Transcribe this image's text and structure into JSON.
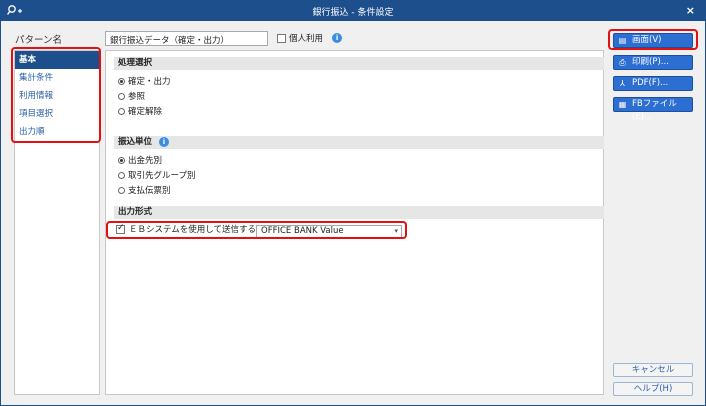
{
  "window": {
    "title": "銀行振込 - 条件設定",
    "close_symbol": "×"
  },
  "header": {
    "pattern_label": "パターン名",
    "pattern_value": "銀行振込データ（確定・出力）",
    "personal_label": "個人利用"
  },
  "sidebar": {
    "items": [
      {
        "label": "基本"
      },
      {
        "label": "集計条件"
      },
      {
        "label": "利用情報"
      },
      {
        "label": "項目選択"
      },
      {
        "label": "出力順"
      }
    ]
  },
  "sections": {
    "processing": {
      "title": "処理選択",
      "options": [
        "確定・出力",
        "参照",
        "確定解除"
      ],
      "selected": "確定・出力"
    },
    "unit": {
      "title": "振込単位",
      "options": [
        "出金先別",
        "取引先グループ別",
        "支払伝票別"
      ],
      "selected": "出金先別"
    },
    "output": {
      "title": "出力形式",
      "eb_label": "ＥＢシステムを使用して送信する",
      "eb_checked": true,
      "eb_value": "OFFICE BANK Value"
    }
  },
  "actions": {
    "screen": "画面(V)",
    "print": "印刷(P)...",
    "pdf": "PDF(F)...",
    "fb": "FBファイル(E)...",
    "cancel": "キャンセル",
    "help": "ヘルプ(H)"
  },
  "colors": {
    "titlebar": "#1d4f8c",
    "accent": "#2d6ed3",
    "highlight": "#e31010"
  }
}
